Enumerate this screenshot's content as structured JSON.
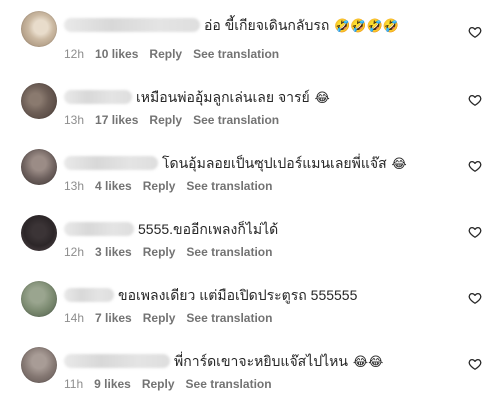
{
  "colors": {
    "text": "#262626",
    "meta": "#8e8e8e",
    "meta_bold": "#737373",
    "background": "#ffffff"
  },
  "icons": {
    "like": "heart-outline-icon"
  },
  "comments": [
    {
      "text": "อ่อ ขี้เกียจเดินกลับรถ",
      "emoji": "🤣🤣🤣🤣",
      "time": "12h",
      "likes": "10 likes",
      "reply": "Reply",
      "translate": "See translation"
    },
    {
      "text": "เหมือนพ่ออุ้มลูกเล่นเลย จารย์",
      "emoji": "😂",
      "time": "13h",
      "likes": "17 likes",
      "reply": "Reply",
      "translate": "See translation"
    },
    {
      "text": "โดนอุ้มลอยเป็นซุปเปอร์แมนเลยพี่แจ๊ส",
      "emoji": "😂",
      "time": "13h",
      "likes": "4 likes",
      "reply": "Reply",
      "translate": "See translation"
    },
    {
      "text": "5555.ขออีกเพลงก็ไม่ได้",
      "emoji": "",
      "time": "12h",
      "likes": "3 likes",
      "reply": "Reply",
      "translate": "See translation"
    },
    {
      "text": "ขอเพลงเดียว แต่มือเปิดประตูรถ 555555",
      "emoji": "",
      "time": "14h",
      "likes": "7 likes",
      "reply": "Reply",
      "translate": "See translation"
    },
    {
      "text": "พี่การ์ดเขาจะหยิบแจ๊สไปไหน",
      "emoji": "😂😂",
      "time": "11h",
      "likes": "9 likes",
      "reply": "Reply",
      "translate": "See translation"
    }
  ]
}
